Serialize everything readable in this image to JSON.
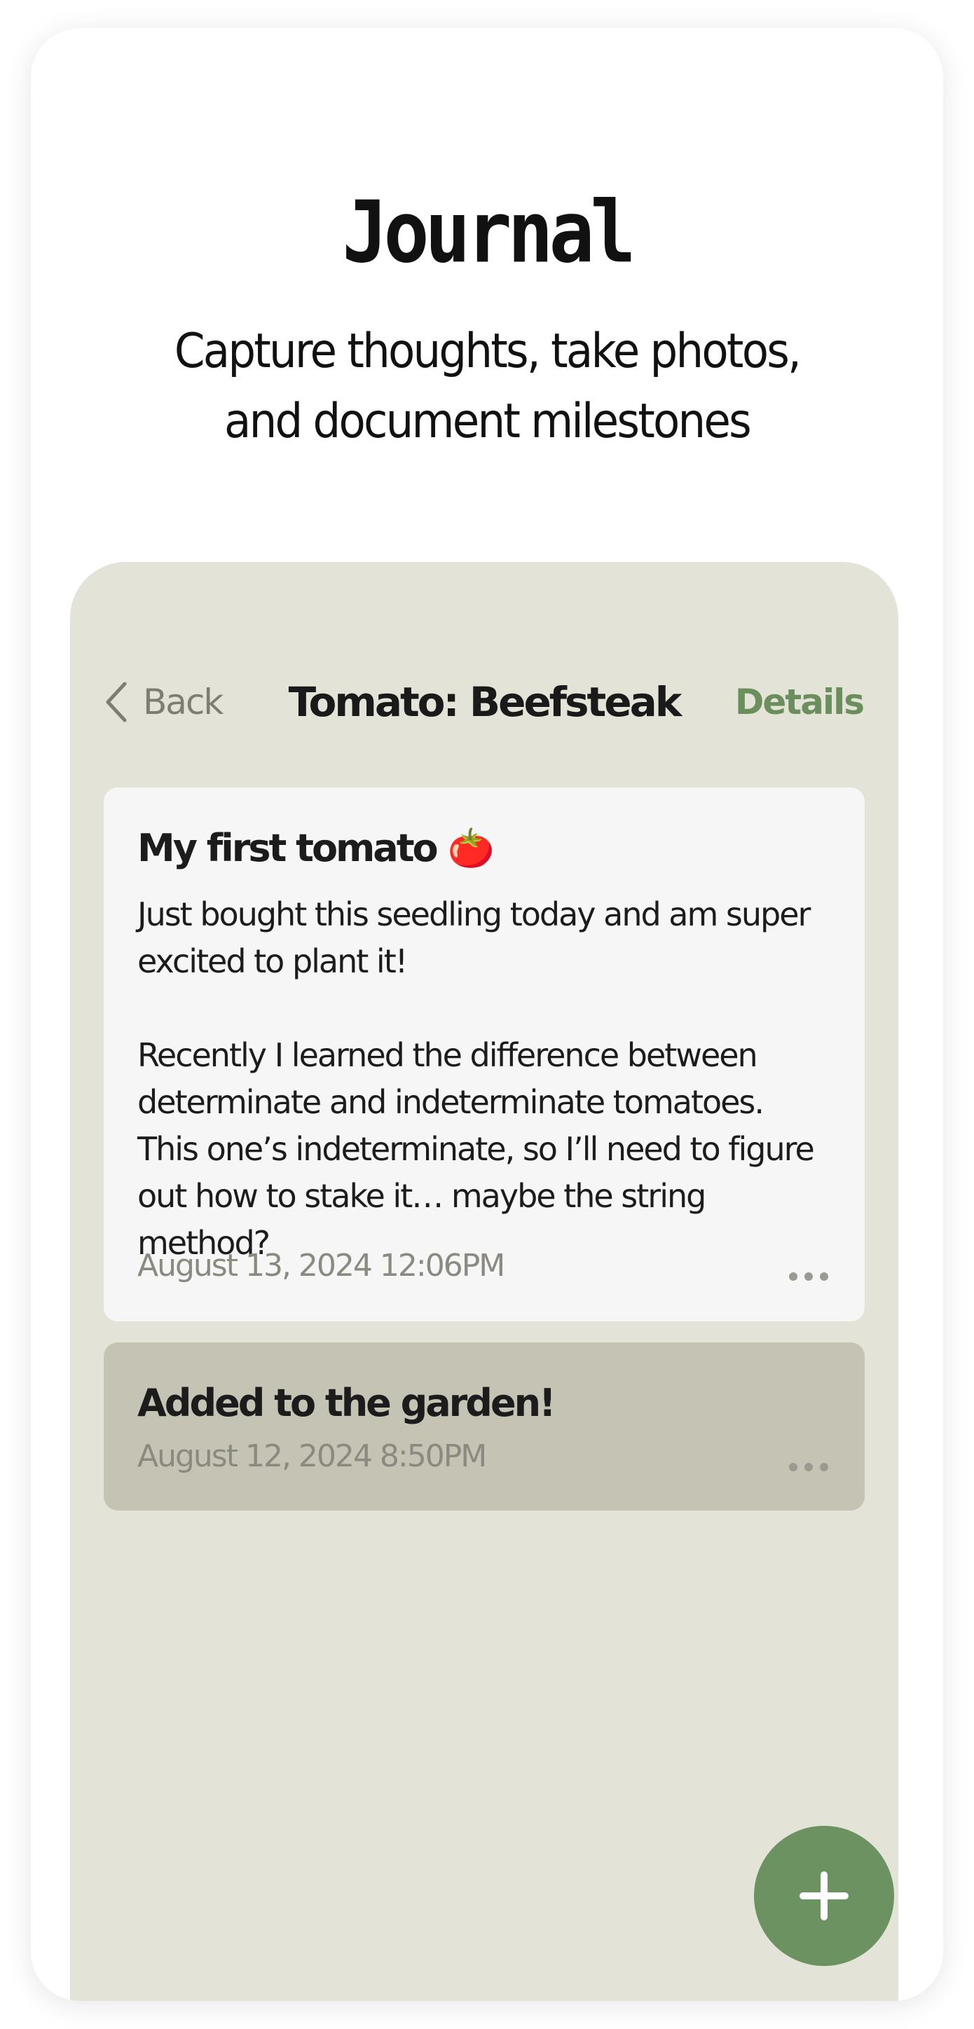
{
  "hero": {
    "title": "Journal",
    "subtitle": "Capture thoughts, take photos,\nand document milestones"
  },
  "nav": {
    "back_label": "Back",
    "title": "Tomato: Beefsteak",
    "details_label": "Details"
  },
  "entries": [
    {
      "title": "My first tomato 🍅",
      "body": "Just bought this seedling today and am super excited to plant it!\n\nRecently I learned the difference between determinate and indeterminate tomatoes. This one’s indeterminate, so I’ll need to figure out how to stake it… maybe the string method?",
      "date": "August 13, 2024 12:06PM"
    },
    {
      "title": "Added to the garden!",
      "date": "August 12, 2024 8:50PM"
    }
  ],
  "fab": {
    "icon": "plus-icon"
  },
  "colors": {
    "accent": "#6b8f5c",
    "panel": "#e3e3d8",
    "entry_highlight": "#c5c4b4"
  }
}
